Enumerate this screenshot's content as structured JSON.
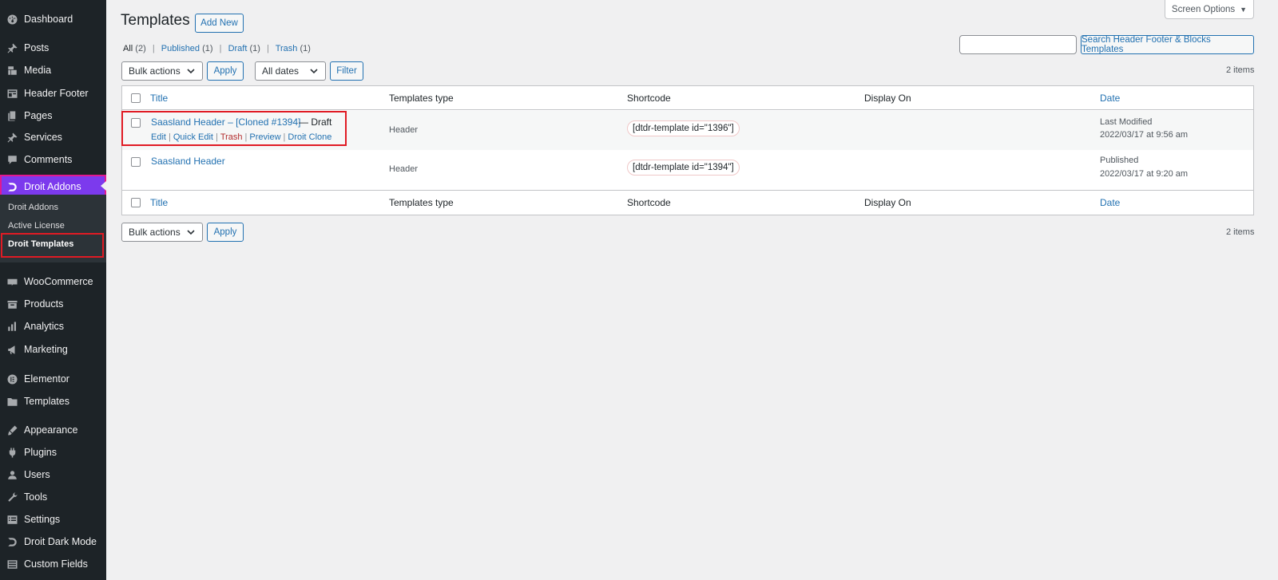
{
  "sidebar": {
    "items": [
      {
        "label": "Dashboard",
        "icon": "dashboard-icon"
      },
      {
        "label": "Posts",
        "icon": "pin-icon"
      },
      {
        "label": "Media",
        "icon": "media-icon"
      },
      {
        "label": "Header Footer",
        "icon": "layout-icon"
      },
      {
        "label": "Pages",
        "icon": "pages-icon"
      },
      {
        "label": "Services",
        "icon": "pin-icon"
      },
      {
        "label": "Comments",
        "icon": "comment-icon"
      },
      {
        "label": "Droit Addons",
        "icon": "droit-logo-icon"
      },
      {
        "label": "WooCommerce",
        "icon": "woo-icon"
      },
      {
        "label": "Products",
        "icon": "archive-icon"
      },
      {
        "label": "Analytics",
        "icon": "bar-chart-icon"
      },
      {
        "label": "Marketing",
        "icon": "megaphone-icon"
      },
      {
        "label": "Elementor",
        "icon": "elementor-icon"
      },
      {
        "label": "Templates",
        "icon": "folder-icon"
      },
      {
        "label": "Appearance",
        "icon": "brush-icon"
      },
      {
        "label": "Plugins",
        "icon": "plugin-icon"
      },
      {
        "label": "Users",
        "icon": "user-icon"
      },
      {
        "label": "Tools",
        "icon": "wrench-icon"
      },
      {
        "label": "Settings",
        "icon": "settings-icon"
      },
      {
        "label": "Droit Dark Mode",
        "icon": "droit-logo-icon"
      },
      {
        "label": "Custom Fields",
        "icon": "fields-icon"
      }
    ],
    "submenu": [
      "Droit Addons",
      "Active License",
      "Droit Templates"
    ]
  },
  "header": {
    "title": "Templates",
    "add_new": "Add New",
    "screen_options": "Screen Options"
  },
  "filters": {
    "views": [
      {
        "label": "All",
        "count": "(2)"
      },
      {
        "label": "Published",
        "count": "(1)"
      },
      {
        "label": "Draft",
        "count": "(1)"
      },
      {
        "label": "Trash",
        "count": "(1)"
      }
    ],
    "separator": "|",
    "bulk_actions": "Bulk actions",
    "apply": "Apply",
    "all_dates": "All dates",
    "filter": "Filter",
    "search_button": "Search Header Footer & Blocks Templates",
    "items_count": "2 items"
  },
  "table": {
    "columns": [
      "Title",
      "Templates type",
      "Shortcode",
      "Display On",
      "Date"
    ],
    "rows": [
      {
        "title": "Saasland Header – [Cloned #1394]",
        "state": "— Draft",
        "actions": [
          "Edit",
          "Quick Edit",
          "Trash",
          "Preview",
          "Droit Clone"
        ],
        "type": "Header",
        "shortcode": "[dtdr-template id=\"1396\"]",
        "display_on": "",
        "date_status": "Last Modified",
        "date": "2022/03/17 at 9:56 am"
      },
      {
        "title": "Saasland Header",
        "state": "",
        "actions": [],
        "type": "Header",
        "shortcode": "[dtdr-template id=\"1394\"]",
        "display_on": "",
        "date_status": "Published",
        "date": "2022/03/17 at 9:20 am"
      }
    ]
  },
  "bottom": {
    "bulk_actions": "Bulk actions",
    "apply": "Apply",
    "items_count": "2 items"
  },
  "colors": {
    "sidebar_bg": "#1d2327",
    "accent": "#2271b1",
    "active_menu": "#7c3aed",
    "highlight_box": "#e01b24"
  }
}
